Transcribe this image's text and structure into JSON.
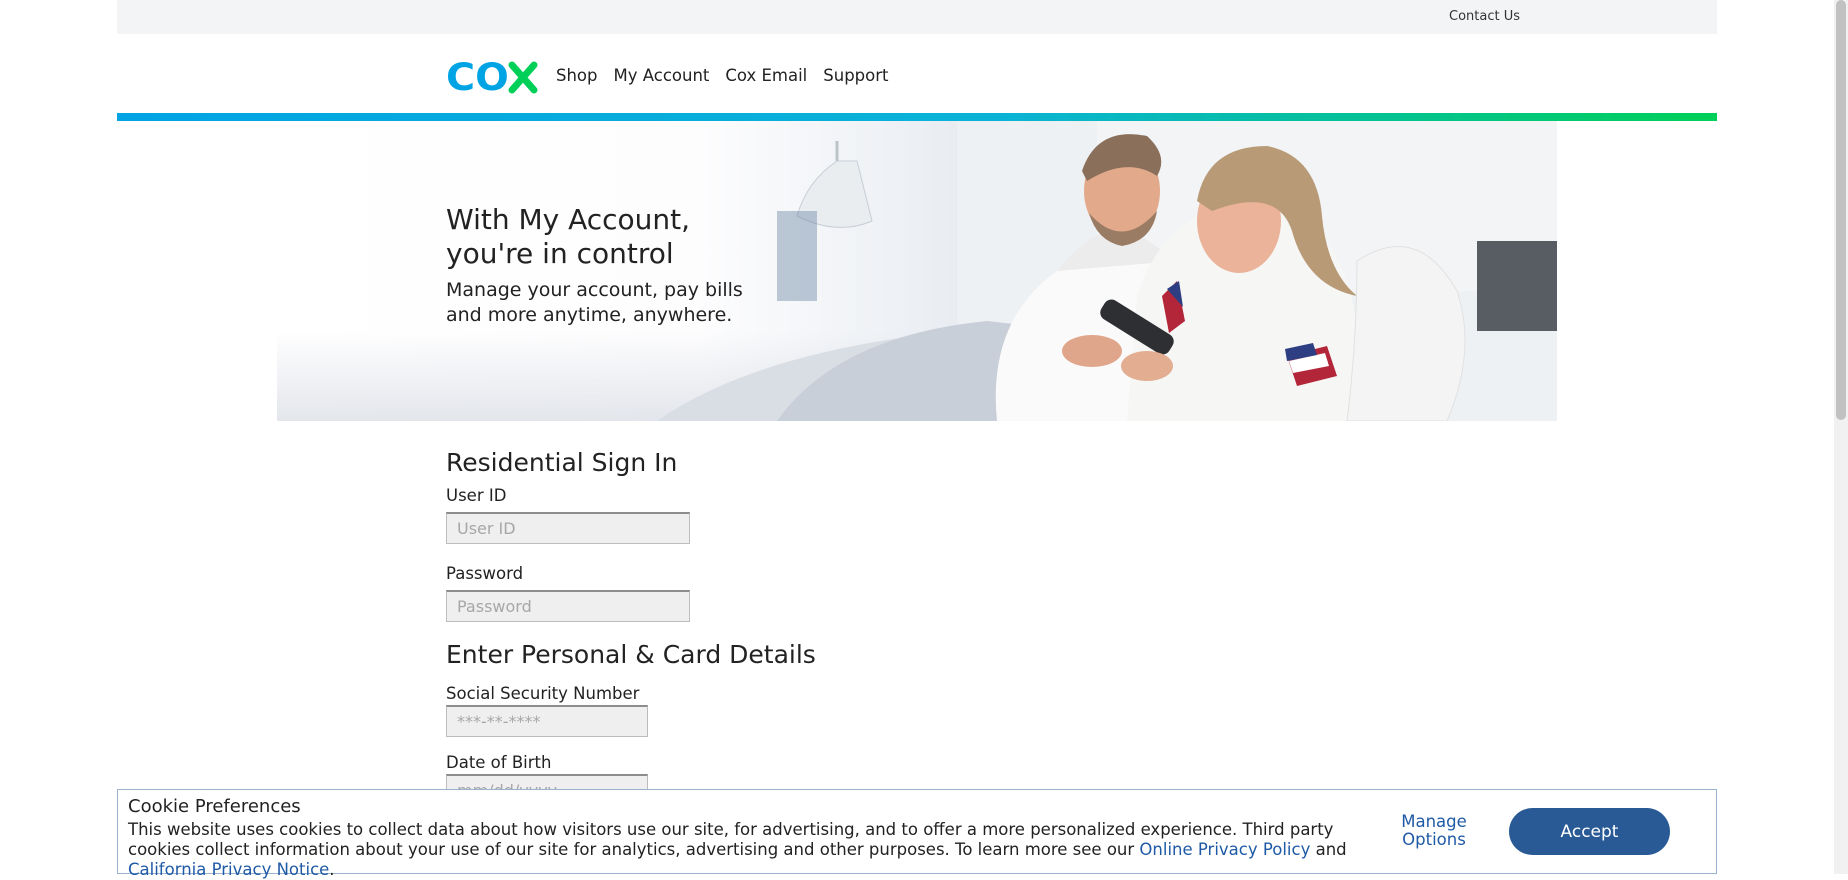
{
  "utility": {
    "contact_label": "Contact Us"
  },
  "header": {
    "logo_text": "COX",
    "nav": [
      "Shop",
      "My Account",
      "Cox Email",
      "Support"
    ]
  },
  "hero": {
    "title_line1": "With My Account,",
    "title_line2": "you're in control",
    "subtitle_line1": "Manage your account, pay bills",
    "subtitle_line2": "and more anytime, anywhere."
  },
  "signin": {
    "heading": "Residential Sign In",
    "userid_label": "User ID",
    "userid_placeholder": "User ID",
    "password_label": "Password",
    "password_placeholder": "Password"
  },
  "details": {
    "heading": "Enter Personal & Card Details",
    "ssn_label": "Social Security Number",
    "ssn_placeholder": "***-**-****",
    "dob_label": "Date of Birth",
    "dob_placeholder": "mm/dd/yyyy"
  },
  "cookie": {
    "title": "Cookie Preferences",
    "text_part1": "This website uses cookies to collect data about how visitors use our site, for advertising, and to offer a more personalized experience. Third party cookies collect information about your use of our site for analytics, advertising and other purposes. To learn more see our ",
    "privacy_link": "Online Privacy Policy",
    "text_and": " and ",
    "ca_link": "California Privacy Notice",
    "text_end": ".",
    "manage_line1": "Manage",
    "manage_line2": "Options",
    "accept_label": "Accept"
  },
  "colors": {
    "brand_blue": "#00a4e4",
    "brand_green": "#00d058",
    "link_blue": "#1f5aa6",
    "button_blue": "#295a96"
  }
}
